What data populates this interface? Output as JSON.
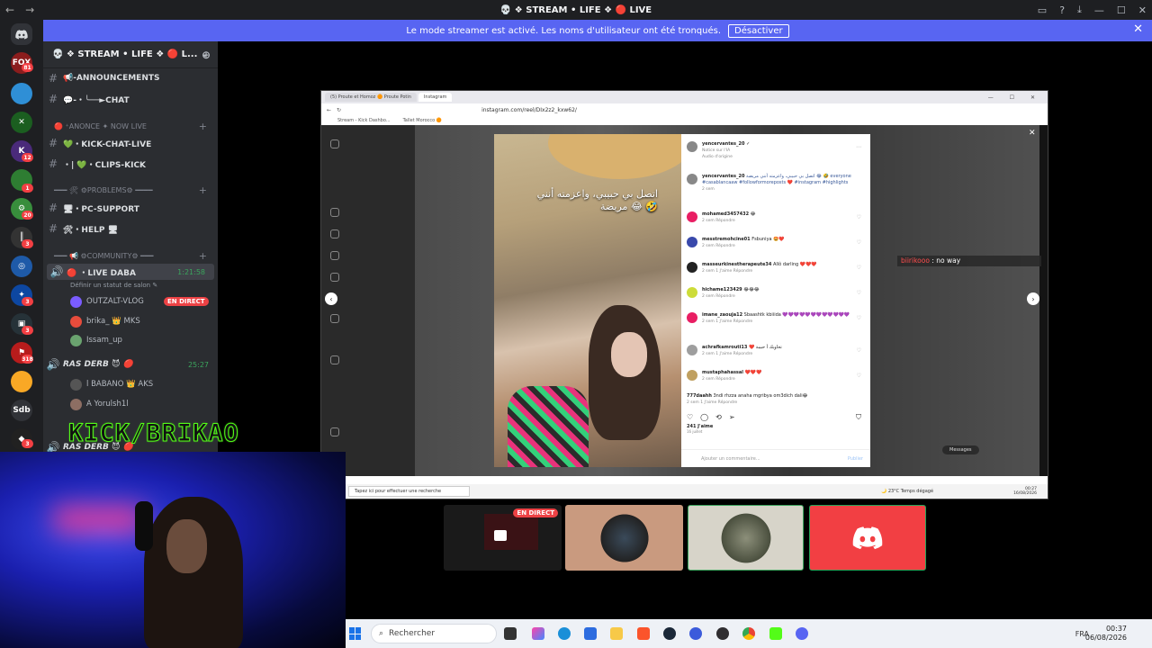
{
  "titlebar": {
    "back": "←",
    "forward": "→",
    "title": "💀 ❖ STREAM • LIFE ❖ 🔴 LIVE"
  },
  "banner": {
    "text": "Le mode streamer est activé. Les noms d'utilisateur ont été tronqués.",
    "button": "Désactiver",
    "close": "✕"
  },
  "rail": {
    "badges": [
      "81",
      "12",
      "1",
      "20",
      "3",
      "26",
      "3",
      "3",
      "318",
      "3"
    ],
    "sdb": "Sdb"
  },
  "server": {
    "name": "💀 ❖ STREAM • LIFE ❖ 🔴 L...",
    "chevron": "⌄"
  },
  "channels": [
    {
      "icon": "#",
      "label": "📢-ANNOUNCEMENTS"
    },
    {
      "icon": "#",
      "label": "💬-・╰──►CHAT"
    },
    {
      "icon": "",
      "label": "🔴 ⁺ANONCE ✦ NOW LIVE",
      "category": true
    },
    {
      "icon": "#",
      "label": "💚・KICK-CHAT-LIVE"
    },
    {
      "icon": "#",
      "label": "・| 💚・CLIPS-KICK"
    },
    {
      "icon": "",
      "label": "━━━ 🛠 ⚙PROBLEMS⚙ ━━━━",
      "category": true
    },
    {
      "icon": "#",
      "label": "🖥・PC-SUPPORT"
    },
    {
      "icon": "#",
      "label": "🛠・HELP 🖥"
    },
    {
      "icon": "",
      "label": "━━━ 📢 ⚙COMMUNITY⚙ ━━━",
      "category": true
    }
  ],
  "voice": {
    "live_channel": "🔴 ・LIVE DABA",
    "live_timer": "1:21:58",
    "status_hint": "Définir un statut de salon ✎",
    "users": [
      "OUTZALT-VLOG",
      "brika_ 👑 MKS",
      "Issam_up"
    ],
    "live_badge": "EN DIRECT",
    "ras_derb": "RAS DERB 😈 🔴",
    "ras_timer": "25:27",
    "ras_users": [
      "l BABANO 👑 AKS",
      "A Yorulsh1l"
    ],
    "ras_derb2": "RAS DERB 😈 🔴"
  },
  "kick_overlay": "KICK/BRIKAO",
  "browser": {
    "tabs": [
      "(5) Proute et Homoz 🟠 Proute Potin",
      "Instagram"
    ],
    "url": "instagram.com/reel/DIx2z2_kxw62/",
    "bookmarks": [
      "Stream - Kick Dashbo...",
      "Tallet Morocco 🟠"
    ],
    "post_author": "yencervantes_20 ✓",
    "post_sub": "Notice sur l'IA",
    "post_sub2": "Audio d'origine",
    "caption_user": "yencervantes_20",
    "caption": "اتصل بي حبيبي، واعزمته أنني مريضة 😂 🤣 everyone #casablancaaw #followformoreposts ❤️ #instagram #highlights",
    "caption_meta": "2 sem",
    "arabic_overlay": "اتصل بي حبيبي، واعزمته أنني مريضة 😂 🤣",
    "comments": [
      {
        "user": "mohamed3457432",
        "text": "😂",
        "meta": "2 sem    Répondre"
      },
      {
        "user": "messtremohcine01",
        "text": "Fsbuniya 🤩❤️",
        "meta": "2 sem    Répondre"
      },
      {
        "user": "masseurkinestherapeute34",
        "text": "Allô darling ❤️❤️❤️",
        "meta": "2 sem    1 J'aime    Répondre"
      },
      {
        "user": "hichame123429",
        "text": "😂😂😂",
        "meta": "2 sem    Répondre"
      },
      {
        "user": "imane_zaouja12",
        "text": "Sbaashtk kbiiida 💜💜💜💜💜💜💜💜💜💜💜💜",
        "meta": "2 sem    1 J'aime    Répondre"
      },
      {
        "user": "achrafkamrouti13",
        "text": "❤️ تحاويك أ حبيبة",
        "meta": "2 sem    1 J'aime    Répondre"
      },
      {
        "user": "mustaphahassal",
        "text": "❤️❤️❤️",
        "meta": "2 sem    Répondre"
      },
      {
        "user": "777daahh",
        "text": "3ndi rhzza anaha mgribya om3dich dali😂",
        "meta": "2 sem    1 J'aime    Répondre"
      }
    ],
    "likes": "241 J'aime",
    "likes_date": "16 juillet",
    "comment_placeholder": "Ajouter un commentaire...",
    "post_button": "Publier",
    "overlay_user": "biirikooo",
    "overlay_msg": ": no way",
    "messages_label": "Messages",
    "taskbar_search": "Tapez ici pour effectuer une recherche",
    "weather": "🌙 23°C  Temps dégagé",
    "clock": "00:27\n16/08/2026"
  },
  "thumbs": {
    "live": "EN DIRECT"
  },
  "taskbar": {
    "search": "Rechercher",
    "lang": "FRA",
    "time": "00:37",
    "date": "06/08/2026"
  },
  "colors": {
    "discord_blurple": "#5865f2",
    "live_red": "#ed4245",
    "kick_green": "#53fc18"
  }
}
